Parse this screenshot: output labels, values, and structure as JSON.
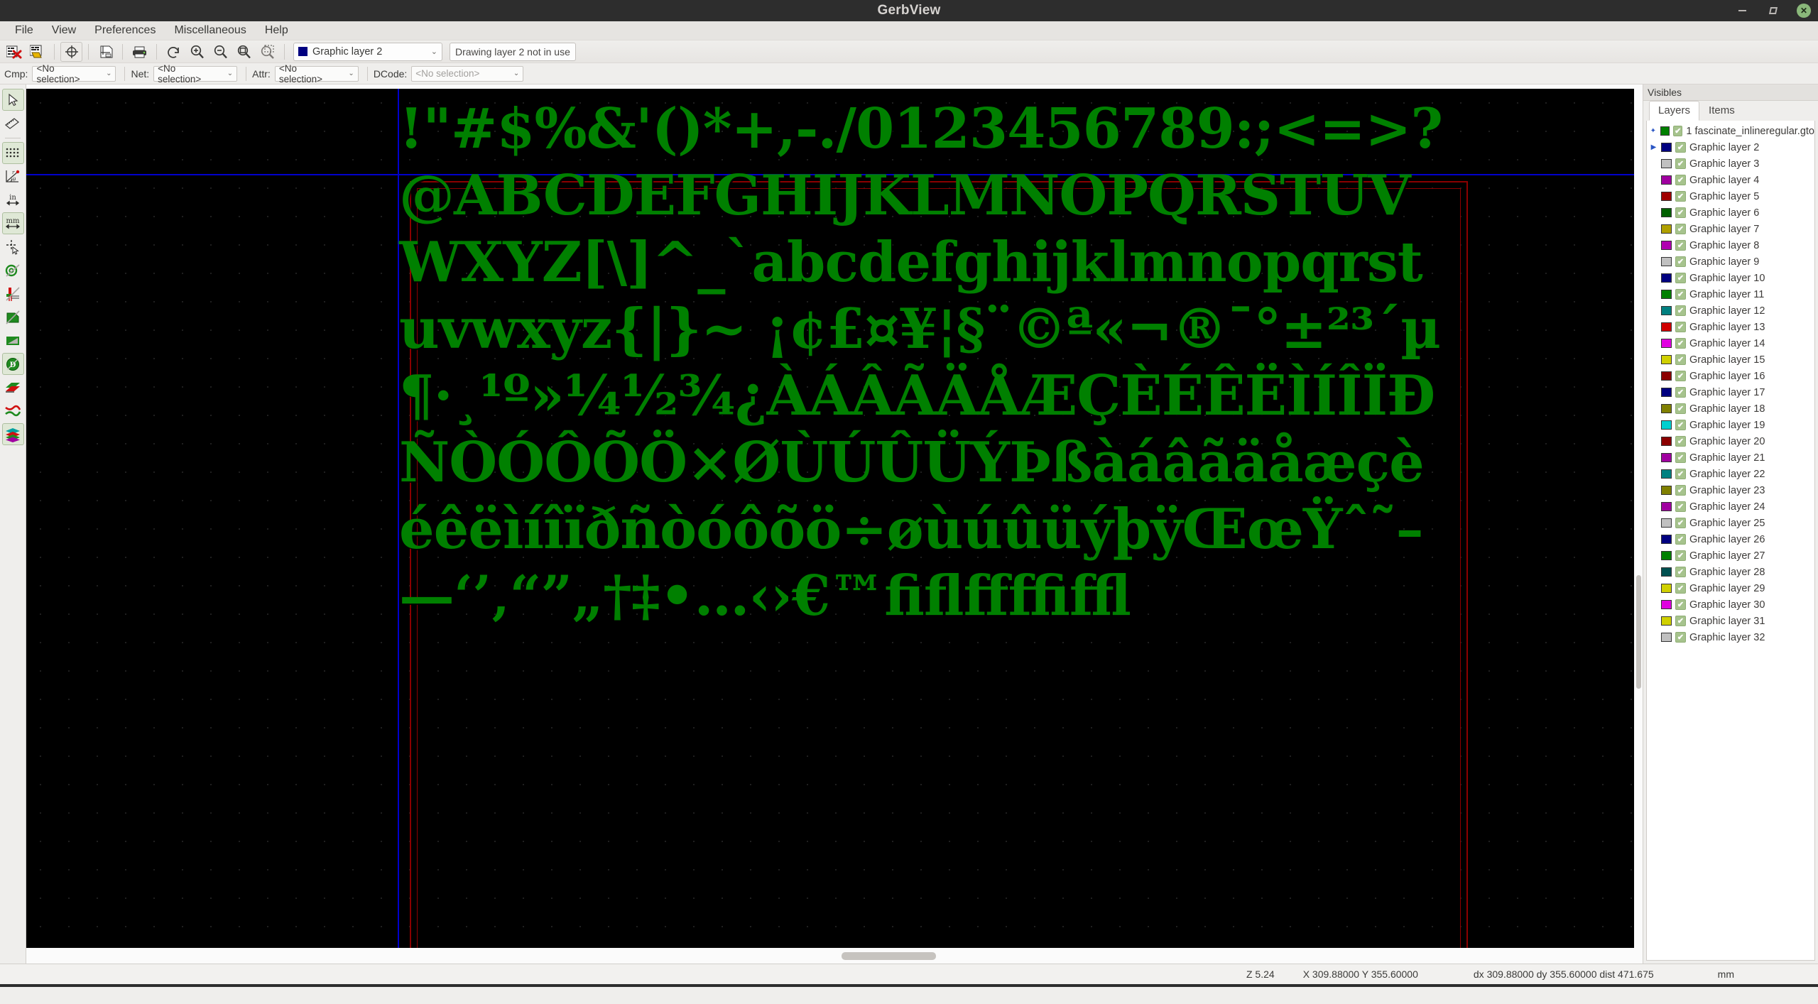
{
  "window": {
    "title": "GerbView",
    "controls": [
      {
        "name": "minimize",
        "glyph": "–"
      },
      {
        "name": "maximize",
        "glyph": "◩"
      },
      {
        "name": "close",
        "glyph": "✕"
      }
    ]
  },
  "menubar": {
    "items": [
      "File",
      "View",
      "Preferences",
      "Miscellaneous",
      "Help"
    ]
  },
  "toolbar": {
    "buttons": [
      {
        "name": "clear-layers",
        "title": "Clear all layers"
      },
      {
        "name": "open-gerber-file",
        "title": "Open Gerber file"
      },
      {
        "name": "refresh-view",
        "title": "Refresh view"
      },
      {
        "name": "page-settings",
        "title": "Page settings"
      },
      {
        "name": "print",
        "title": "Print"
      },
      {
        "name": "redo",
        "title": "Redo"
      },
      {
        "name": "zoom-in",
        "title": "Zoom in"
      },
      {
        "name": "zoom-out",
        "title": "Zoom out"
      },
      {
        "name": "zoom-fit",
        "title": "Zoom to fit"
      },
      {
        "name": "zoom-area",
        "title": "Zoom to selection"
      }
    ],
    "layer_select": {
      "value": "Graphic layer 2",
      "swatch_color": "#000080",
      "chevron": "⌄"
    },
    "status_text": "Drawing layer 2 not in use"
  },
  "filterbar": {
    "groups": [
      {
        "label": "Cmp:",
        "value": "<No selection>",
        "placeholder": false,
        "width": "w1"
      },
      {
        "label": "Net:",
        "value": "<No selection>",
        "placeholder": false,
        "width": "w1"
      },
      {
        "label": "Attr:",
        "value": "<No selection>",
        "placeholder": false,
        "width": "w1"
      },
      {
        "label": "DCode:",
        "value": "<No selection>",
        "placeholder": true,
        "width": "w2"
      }
    ],
    "chevron": "⌄"
  },
  "left_toolbar": {
    "buttons": [
      {
        "name": "select-tool",
        "active": true
      },
      {
        "name": "measure-tool",
        "active": false
      },
      {
        "name": "separator",
        "active": false
      },
      {
        "name": "toggle-grid",
        "active": true
      },
      {
        "name": "polar-coordinates",
        "active": false
      },
      {
        "name": "units-inches",
        "active": false
      },
      {
        "name": "units-millimeters",
        "active": true
      },
      {
        "name": "full-crosshair-cursor",
        "active": false
      },
      {
        "name": "show-pads-sketch",
        "active": false
      },
      {
        "name": "show-tracks-sketch",
        "active": false
      },
      {
        "name": "show-polygons-sketch",
        "active": false
      },
      {
        "name": "negative-objects",
        "active": false
      },
      {
        "name": "show-dcodes",
        "active": true
      },
      {
        "name": "high-contrast-mode",
        "active": false
      },
      {
        "name": "show-differences",
        "active": false
      },
      {
        "name": "layers-manager",
        "active": true
      }
    ]
  },
  "canvas": {
    "background_color": "#000000",
    "trace_color": "#008000",
    "axis_color": "#0000cc",
    "outline_color": "#8b0000",
    "gerber_text": "!\"#$%&'()*+,-./0123456789:;<=>?@ABCDEFGHIJKLMNOPQRSTUVWXYZ[\\]^_`abcdefghijklmnopqrstuvwxyz{|}~ ¡¢£¤¥¦§¨©ª«¬­®¯°±²³´µ¶·¸¹º»¼½¾¿ÀÁÂÃÄÅÆÇÈÉÊËÌÍÎÏÐÑÒÓÔÕÖ×ØÙÚÛÜÝÞßàáâãäåæçèéêëìíîïðñòóôõö÷øùúûüýþÿŒœŸˆ˜–—‘’‚“”„†‡•…‹›€™ﬁﬂﬀﬃﬄ"
  },
  "right_panel": {
    "title": "Visibles",
    "tabs": [
      {
        "label": "Layers",
        "active": true
      },
      {
        "label": "Items",
        "active": false
      }
    ],
    "layers": [
      {
        "name": "1 fascinate_inlineregular.gto",
        "color": "#008000",
        "visible": true,
        "marker": "✦"
      },
      {
        "name": "Graphic layer 2",
        "color": "#000080",
        "visible": true,
        "marker": "▶"
      },
      {
        "name": "Graphic layer 3",
        "color": "#c0c0c0",
        "visible": true,
        "marker": ""
      },
      {
        "name": "Graphic layer 4",
        "color": "#a000a0",
        "visible": true,
        "marker": ""
      },
      {
        "name": "Graphic layer 5",
        "color": "#a00000",
        "visible": true,
        "marker": ""
      },
      {
        "name": "Graphic layer 6",
        "color": "#006000",
        "visible": true,
        "marker": ""
      },
      {
        "name": "Graphic layer 7",
        "color": "#b0a000",
        "visible": true,
        "marker": ""
      },
      {
        "name": "Graphic layer 8",
        "color": "#b000b0",
        "visible": true,
        "marker": ""
      },
      {
        "name": "Graphic layer 9",
        "color": "#c0c0c0",
        "visible": true,
        "marker": ""
      },
      {
        "name": "Graphic layer 10",
        "color": "#000080",
        "visible": true,
        "marker": ""
      },
      {
        "name": "Graphic layer 11",
        "color": "#008000",
        "visible": true,
        "marker": ""
      },
      {
        "name": "Graphic layer 12",
        "color": "#008080",
        "visible": true,
        "marker": ""
      },
      {
        "name": "Graphic layer 13",
        "color": "#d00000",
        "visible": true,
        "marker": ""
      },
      {
        "name": "Graphic layer 14",
        "color": "#e000e0",
        "visible": true,
        "marker": ""
      },
      {
        "name": "Graphic layer 15",
        "color": "#d0d000",
        "visible": true,
        "marker": ""
      },
      {
        "name": "Graphic layer 16",
        "color": "#8b0000",
        "visible": true,
        "marker": ""
      },
      {
        "name": "Graphic layer 17",
        "color": "#000080",
        "visible": true,
        "marker": ""
      },
      {
        "name": "Graphic layer 18",
        "color": "#808000",
        "visible": true,
        "marker": ""
      },
      {
        "name": "Graphic layer 19",
        "color": "#00d0d0",
        "visible": true,
        "marker": ""
      },
      {
        "name": "Graphic layer 20",
        "color": "#8b0000",
        "visible": true,
        "marker": ""
      },
      {
        "name": "Graphic layer 21",
        "color": "#a000a0",
        "visible": true,
        "marker": ""
      },
      {
        "name": "Graphic layer 22",
        "color": "#008080",
        "visible": true,
        "marker": ""
      },
      {
        "name": "Graphic layer 23",
        "color": "#808000",
        "visible": true,
        "marker": ""
      },
      {
        "name": "Graphic layer 24",
        "color": "#a000a0",
        "visible": true,
        "marker": ""
      },
      {
        "name": "Graphic layer 25",
        "color": "#c0c0c0",
        "visible": true,
        "marker": ""
      },
      {
        "name": "Graphic layer 26",
        "color": "#000080",
        "visible": true,
        "marker": ""
      },
      {
        "name": "Graphic layer 27",
        "color": "#008000",
        "visible": true,
        "marker": ""
      },
      {
        "name": "Graphic layer 28",
        "color": "#005050",
        "visible": true,
        "marker": ""
      },
      {
        "name": "Graphic layer 29",
        "color": "#d0d000",
        "visible": true,
        "marker": ""
      },
      {
        "name": "Graphic layer 30",
        "color": "#e000e0",
        "visible": true,
        "marker": ""
      },
      {
        "name": "Graphic layer 31",
        "color": "#d0d000",
        "visible": true,
        "marker": ""
      },
      {
        "name": "Graphic layer 32",
        "color": "#c0c0c0",
        "visible": true,
        "marker": ""
      }
    ],
    "checkmark": "✔"
  },
  "statusbar": {
    "zoom": "Z 5.24",
    "coords": "X 309.88000  Y 355.60000",
    "delta": "dx 309.88000  dy 355.60000  dist 471.675",
    "units": "mm"
  }
}
